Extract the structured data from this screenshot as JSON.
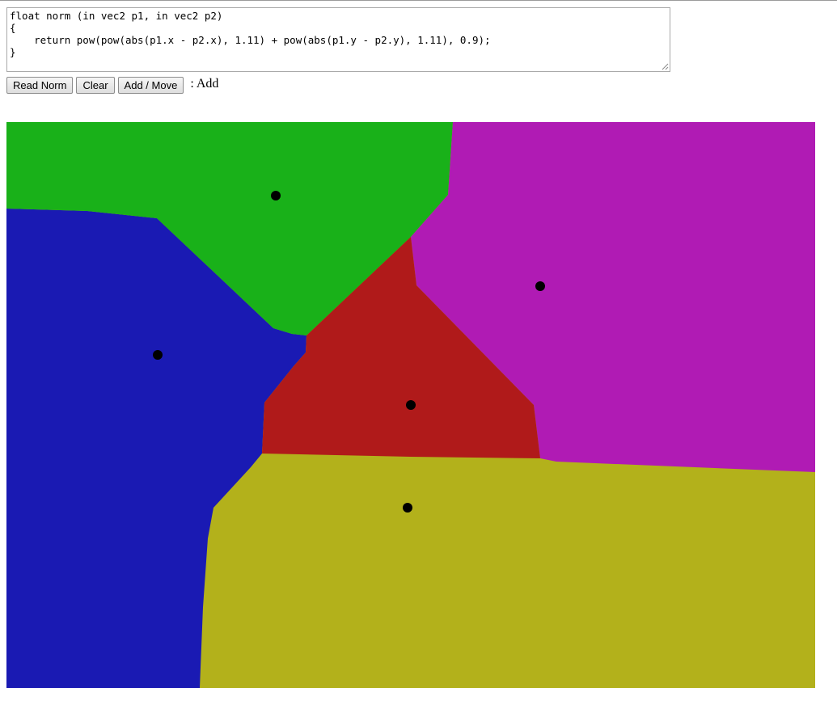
{
  "editor": {
    "lines": [
      "float norm (in vec2 p1, in vec2 p2)",
      "{",
      "    return pow(pow(abs(p1.x - p2.x), 1.11) + pow(abs(p1.y - p2.y), 1.11), 0.9);",
      "}"
    ]
  },
  "toolbar": {
    "read_norm_label": "Read Norm",
    "clear_label": "Clear",
    "add_move_label": "Add / Move",
    "mode_text": " : Add"
  },
  "canvas": {
    "site_color": "#000000",
    "regions": [
      {
        "name": "green",
        "color": "#19b119"
      },
      {
        "name": "magenta",
        "color": "#b01bb4"
      },
      {
        "name": "blue",
        "color": "#1a1ab3"
      },
      {
        "name": "red",
        "color": "#b01a1a"
      },
      {
        "name": "olive",
        "color": "#b3b11b"
      }
    ]
  }
}
